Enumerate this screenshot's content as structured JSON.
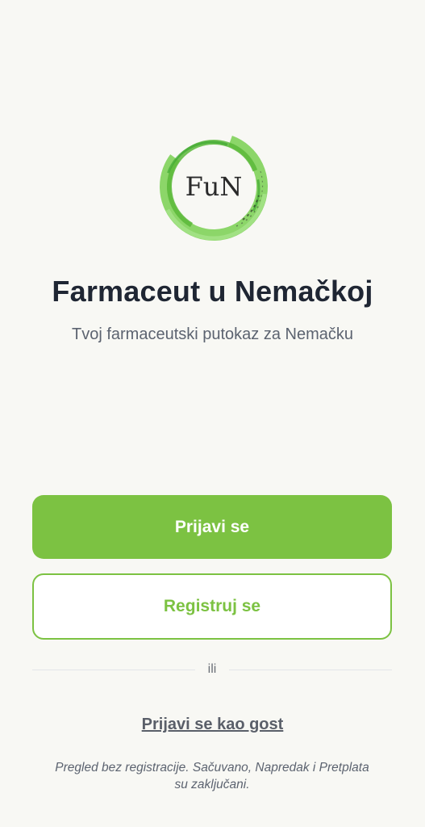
{
  "logo": {
    "text": "FuN",
    "icon": "green-brush-circle-logo",
    "color": "#6cc24a"
  },
  "title": "Farmaceut u Nemačkoj",
  "subtitle": "Tvoj farmaceutski putokaz za Nemačku",
  "buttons": {
    "login_label": "Prijavi se",
    "register_label": "Registruj se"
  },
  "divider": {
    "label": "ili"
  },
  "guest": {
    "label": "Prijavi se kao gost"
  },
  "note": {
    "line1": "Pregled bez registracije. Sačuvano, Napredak i Pretplata",
    "line2": "su zaključani."
  },
  "colors": {
    "accent": "#7cc242",
    "background": "#f8f8f4",
    "title": "#1f2633",
    "muted": "#5c6370"
  }
}
